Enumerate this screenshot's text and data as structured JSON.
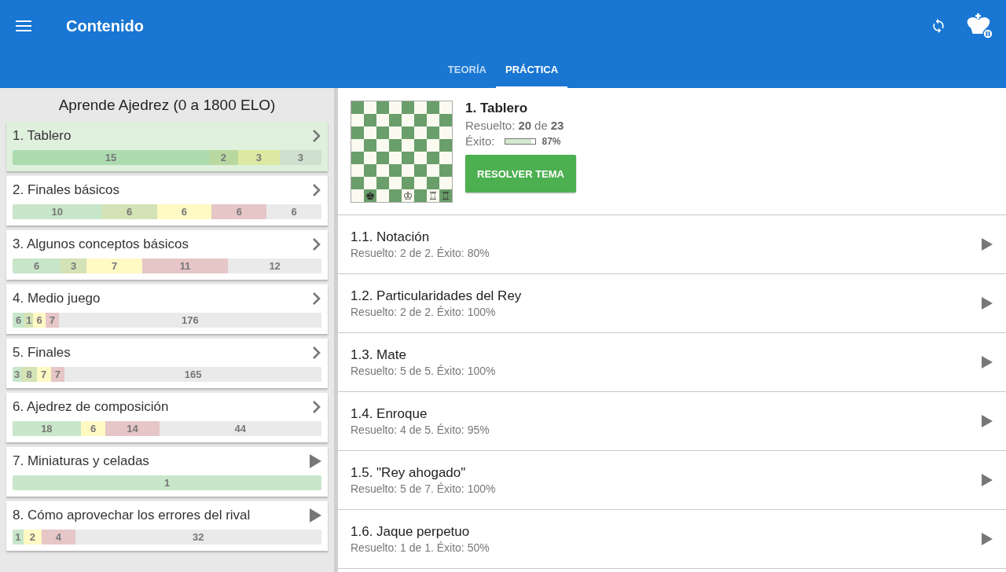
{
  "app_bar": {
    "title": "Contenido"
  },
  "tabs": [
    {
      "label": "TEORÍA",
      "selected": false
    },
    {
      "label": "PRÁCTICA",
      "selected": true
    }
  ],
  "course": {
    "title": "Aprende Ajedrez (0 a 1800 ELO)",
    "chapters": [
      {
        "title": "1. Tablero",
        "kind": "group",
        "selected": true,
        "segments": [
          {
            "kind": "great",
            "count": "15"
          },
          {
            "kind": "good",
            "count": "2"
          },
          {
            "kind": "ok",
            "count": "3"
          },
          {
            "kind": "none",
            "count": "3"
          }
        ]
      },
      {
        "title": "2. Finales básicos",
        "kind": "group",
        "selected": false,
        "segments": [
          {
            "kind": "great",
            "count": "10"
          },
          {
            "kind": "good",
            "count": "6"
          },
          {
            "kind": "ok",
            "count": "6"
          },
          {
            "kind": "bad",
            "count": "6"
          },
          {
            "kind": "none",
            "count": "6"
          }
        ]
      },
      {
        "title": "3. Algunos conceptos básicos",
        "kind": "group",
        "selected": false,
        "segments": [
          {
            "kind": "great",
            "count": "6"
          },
          {
            "kind": "good",
            "count": "3"
          },
          {
            "kind": "ok",
            "count": "7"
          },
          {
            "kind": "bad",
            "count": "11"
          },
          {
            "kind": "none",
            "count": "12"
          }
        ]
      },
      {
        "title": "4. Medio juego",
        "kind": "group",
        "selected": false,
        "segments": [
          {
            "kind": "great",
            "count": "6"
          },
          {
            "kind": "good",
            "count": "1"
          },
          {
            "kind": "ok",
            "count": "6"
          },
          {
            "kind": "bad",
            "count": "7"
          },
          {
            "kind": "none",
            "count": "176"
          }
        ]
      },
      {
        "title": "5. Finales",
        "kind": "group",
        "selected": false,
        "segments": [
          {
            "kind": "great",
            "count": "3"
          },
          {
            "kind": "good",
            "count": "8"
          },
          {
            "kind": "ok",
            "count": "7"
          },
          {
            "kind": "bad",
            "count": "7"
          },
          {
            "kind": "none",
            "count": "165"
          }
        ]
      },
      {
        "title": "6. Ajedrez de composición",
        "kind": "group",
        "selected": false,
        "segments": [
          {
            "kind": "great",
            "count": "18"
          },
          {
            "kind": "ok",
            "count": "6"
          },
          {
            "kind": "bad",
            "count": "14"
          },
          {
            "kind": "none",
            "count": "44"
          }
        ]
      },
      {
        "title": "7. Miniaturas y celadas",
        "kind": "topic",
        "selected": false,
        "segments": [
          {
            "kind": "great",
            "count": "1"
          }
        ]
      },
      {
        "title": "8. Cómo aprovechar los errores del rival",
        "kind": "topic",
        "selected": false,
        "segments": [
          {
            "kind": "great",
            "count": "1"
          },
          {
            "kind": "ok",
            "count": "2"
          },
          {
            "kind": "bad",
            "count": "4"
          },
          {
            "kind": "none",
            "count": "32"
          }
        ]
      }
    ]
  },
  "topic": {
    "title": "1. Tablero",
    "solved_label": "Resuelto:",
    "solved": "20",
    "of": "de",
    "total": "23",
    "success_label": "Éxito:",
    "level": 0.87,
    "success": "87%",
    "button": "RESOLVER TEMA",
    "pieces": [
      "♚",
      "♔",
      "♖",
      "♖"
    ]
  },
  "lessons": [
    {
      "title": "1.1. Notación",
      "summary": "Resuelto: 2 de 2. Éxito: 80%"
    },
    {
      "title": "1.2. Particularidades del Rey",
      "summary": "Resuelto: 2 de 2. Éxito: 100%"
    },
    {
      "title": "1.3. Mate",
      "summary": "Resuelto: 5 de 5. Éxito: 100%"
    },
    {
      "title": "1.4. Enroque",
      "summary": "Resuelto: 4 de 5. Éxito: 95%"
    },
    {
      "title": "1.5. \"Rey ahogado\"",
      "summary": "Resuelto: 5 de 7. Éxito: 100%"
    },
    {
      "title": "1.6. Jaque perpetuo",
      "summary": "Resuelto: 1 de 1. Éxito: 50%"
    }
  ]
}
